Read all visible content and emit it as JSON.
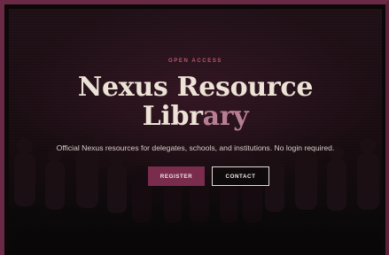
{
  "hero": {
    "eyebrow": "OPEN ACCESS",
    "title_line1": "Nexus Resource",
    "title_line2_main": "Libr",
    "title_line2_accent": "ary",
    "subtitle": "Official Nexus resources for delegates, schools, and institutions. No login required."
  },
  "actions": {
    "register_label": "REGISTER",
    "contact_label": "CONTACT"
  },
  "colors": {
    "frame": "#6a2a45",
    "accent": "#7a2c4c",
    "eyebrow": "#b8576f",
    "title": "#ede2d6",
    "title_accent": "#b57e91"
  }
}
